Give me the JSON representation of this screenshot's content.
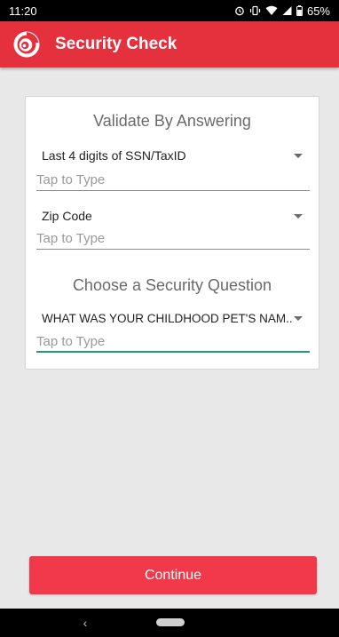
{
  "status_bar": {
    "time": "11:20",
    "battery": "65%",
    "icons": [
      "alarm-icon",
      "vibrate-icon",
      "wifi-icon",
      "signal-icon",
      "battery-icon"
    ]
  },
  "app_bar": {
    "title": "Security Check",
    "logo": "spiral-logo-icon",
    "background_color": "#e5303e"
  },
  "form": {
    "section1_title": "Validate By Answering",
    "ssn_dropdown": {
      "selected": "Last 4 digits of SSN/TaxID"
    },
    "ssn_field": {
      "placeholder": "Tap to Type"
    },
    "zip_dropdown": {
      "selected": "Zip Code"
    },
    "zip_field": {
      "placeholder": "Tap to Type"
    },
    "section2_title": "Choose a Security Question",
    "question_dropdown": {
      "selected": "WHAT WAS YOUR CHILDHOOD PET'S NAM..."
    },
    "question_field": {
      "placeholder": "Tap to Type",
      "active_color": "#1f9e7f"
    }
  },
  "continue_button": {
    "label": "Continue",
    "color": "#f2394a"
  },
  "nav_bar": {
    "back_icon": "back-chevron-icon",
    "home_icon": "home-pill-icon",
    "back_glyph": "‹"
  }
}
